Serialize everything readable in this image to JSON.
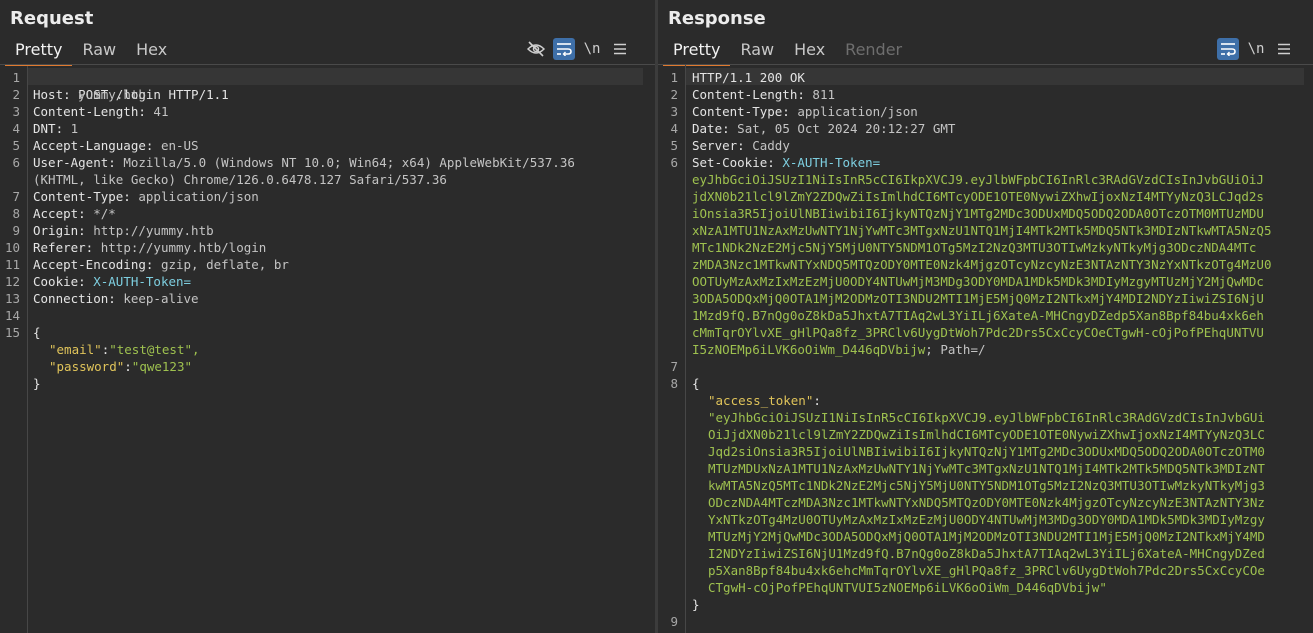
{
  "request": {
    "title": "Request",
    "tabs": [
      "Pretty",
      "Raw",
      "Hex"
    ],
    "line_numbers": [
      "1",
      "2",
      "3",
      "4",
      "5",
      "6",
      "7",
      "8",
      "9",
      "10",
      "11",
      "12",
      "13",
      "14",
      "15"
    ],
    "request_line": "POST /login HTTP/1.1",
    "headers": [
      {
        "name": "Host:",
        "value": "yummy.htb"
      },
      {
        "name": "Content-Length:",
        "value": "41"
      },
      {
        "name": "DNT:",
        "value": "1"
      },
      {
        "name": "Accept-Language:",
        "value": "en-US"
      },
      {
        "name": "User-Agent:",
        "value": "Mozilla/5.0 (Windows NT 10.0; Win64; x64) AppleWebKit/537.36"
      },
      {
        "name": "Content-Type:",
        "value": "application/json"
      },
      {
        "name": "Accept:",
        "value": "*/*"
      },
      {
        "name": "Origin:",
        "value": "http://yummy.htb"
      },
      {
        "name": "Referer:",
        "value": "http://yummy.htb/login"
      },
      {
        "name": "Accept-Encoding:",
        "value": "gzip, deflate, br"
      },
      {
        "name": "Cookie:",
        "value": "X-AUTH-Token="
      },
      {
        "name": "Connection:",
        "value": "keep-alive"
      }
    ],
    "user_agent_cont": "(KHTML, like Gecko) Chrome/126.0.6478.127 Safari/537.36",
    "body_open": "{",
    "body_email_key": "\"email\"",
    "body_email_val": "\"test@test\",",
    "body_password_key": "\"password\"",
    "body_password_val": "\"qwe123\"",
    "body_close": "}",
    "colon": ":"
  },
  "response": {
    "title": "Response",
    "tabs": [
      "Pretty",
      "Raw",
      "Hex",
      "Render"
    ],
    "status_line": "HTTP/1.1 200 OK",
    "headers": [
      {
        "name": "Content-Length:",
        "value": "811"
      },
      {
        "name": "Content-Type:",
        "value": "application/json"
      },
      {
        "name": "Date:",
        "value": "Sat, 05 Oct 2024 20:12:27 GMT"
      },
      {
        "name": "Server:",
        "value": "Caddy"
      }
    ],
    "set_cookie_name": "Set-Cookie:",
    "set_cookie_key": "X-AUTH-Token=",
    "cookie_lines": [
      "eyJhbGciOiJSUzI1NiIsInR5cCI6IkpXVCJ9.eyJlbWFpbCI6InRlc3RAdGVzdCIsInJvbGUiOiJ",
      "jdXN0b21lcl9lZmY2ZDQwZiIsImlhdCI6MTcyODE1OTE0NywiZXhwIjoxNzI4MTYyNzQ3LCJqd2s",
      "iOnsia3R5IjoiUlNBIiwibiI6IjkyNTQzNjY1MTg2MDc3ODUxMDQ5ODQ2ODA0OTczOTM0MTUzMDU",
      "xNzA1MTU1NzAxMzUwNTY1NjYwMTc3MTgxNzU1NTQ1MjI4MTk2MTk5MDQ5NTk3MDIzNTkwMTA5NzQ5",
      "MTc1NDk2NzE2Mjc5NjY5MjU0NTY5NDM1OTg5MzI2NzQ3MTU3OTIwMzkyNTkyMjg3ODczNDA4MTc",
      "zMDA3Nzc1MTkwNTYxNDQ5MTQzODY0MTE0Nzk4MjgzOTcyNzcyNzE3NTAzNTY3NzYxNTkzOTg4MzU0",
      "OOTUyMzAxMzIxMzEzMjU0ODY4NTUwMjM3MDg3ODY0MDA1MDk5MDk3MDIyMzgyMTUzMjY2MjQwMDc",
      "3ODA5ODQxMjQ0OTA1MjM2ODMzOTI3NDU2MTI1MjE5MjQ0MzI2NTkxMjY4MDI2NDYzIiwiZSI6NjU",
      "1Mzd9fQ.B7nQg0oZ8kDa5JhxtA7TIAq2wL3YiILj6XateA-MHCngyDZedp5Xan8Bpf84bu4xk6eh",
      "cMmTqrOYlvXE_gHlPQa8fz_3PRClv6UygDtWoh7Pdc2Drs5CxCcyCOeCTgwH-cOjPofPEhqUNTVU",
      "I5zNOEMp6iLVK6oOiWm_D446qDVbijw"
    ],
    "cookie_tail": "; Path=/",
    "body_open": "{",
    "access_token_key": "\"access_token\"",
    "colon": ":",
    "token_lines": [
      "\"eyJhbGciOiJSUzI1NiIsInR5cCI6IkpXVCJ9.eyJlbWFpbCI6InRlc3RAdGVzdCIsInJvbGUi",
      "OiJjdXN0b21lcl9lZmY2ZDQwZiIsImlhdCI6MTcyODE1OTE0NywiZXhwIjoxNzI4MTYyNzQ3LC",
      "Jqd2siOnsia3R5IjoiUlNBIiwibiI6IjkyNTQzNjY1MTg2MDc3ODUxMDQ5ODQ2ODA0OTczOTM0",
      "MTUzMDUxNzA1MTU1NzAxMzUwNTY1NjYwMTc3MTgxNzU1NTQ1MjI4MTk2MTk5MDQ5NTk3MDIzNT",
      "kwMTA5NzQ5MTc1NDk2NzE2Mjc5NjY5MjU0NTY5NDM1OTg5MzI2NzQ3MTU3OTIwMzkyNTkyMjg3",
      "ODczNDA4MTczMDA3Nzc1MTkwNTYxNDQ5MTQzODY0MTE0Nzk4MjgzOTcyNzcyNzE3NTAzNTY3Nz",
      "YxNTkzOTg4MzU0OTUyMzAxMzIxMzEzMjU0ODY4NTUwMjM3MDg3ODY0MDA1MDk5MDk3MDIyMzgy",
      "MTUzMjY2MjQwMDc3ODA5ODQxMjQ0OTA1MjM2ODMzOTI3NDU2MTI1MjE5MjQ0MzI2NTkxMjY4MD",
      "I2NDYzIiwiZSI6NjU1Mzd9fQ.B7nQg0oZ8kDa5JhxtA7TIAq2wL3YiILj6XateA-MHCngyDZed",
      "p5Xan8Bpf84bu4xk6ehcMmTqrOYlvXE_gHlPQa8fz_3PRClv6UygDtWoh7Pdc2Drs5CxCcyCOe",
      "CTgwH-cOjPofPEhqUNTVUI5zNOEMp6iLVK6oOiWm_D446qDVbijw\""
    ],
    "body_close": "}"
  },
  "icons": {
    "hide": "eye-slash-icon",
    "wrap": "word-wrap-icon",
    "newline": "\\n",
    "menu": "hamburger-menu-icon"
  },
  "colors": {
    "accent_tab": "#e07a2f",
    "toggle_on": "#3e6fa8",
    "cookie": "#7ecfe0",
    "token": "#9ec14f",
    "json_key": "#e0c45a"
  }
}
